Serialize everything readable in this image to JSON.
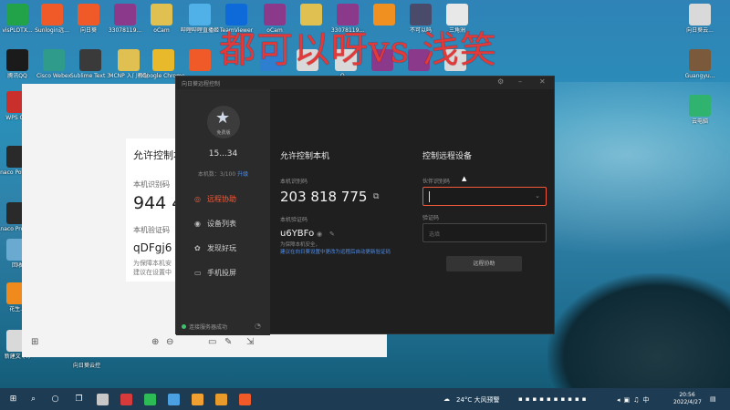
{
  "overlay": {
    "title": "都可以呀vs 浅笑"
  },
  "desktop_icons": [
    {
      "label": "visPLOTX...",
      "color": "#22a34a"
    },
    {
      "label": "Sunlogin远...",
      "color": "#f05a28"
    },
    {
      "label": "向日葵",
      "color": "#f05a28"
    },
    {
      "label": "33078119...",
      "color": "#8b3a8b"
    },
    {
      "label": "oCam",
      "color": "#e0c050"
    },
    {
      "label": "哔哩哔哩直播姬",
      "color": "#4fb1e8"
    },
    {
      "label": "TeamViewer",
      "color": "#0e6ad8"
    },
    {
      "label": "oCam",
      "color": "#8b3a8b"
    },
    {
      "label": "",
      "color": "#e0c050"
    },
    {
      "label": "33078119...",
      "color": "#8b3a8b"
    },
    {
      "label": "",
      "color": "#f09020"
    },
    {
      "label": "不可以吗",
      "color": "#4a4a6a"
    },
    {
      "label": "三角洲",
      "color": "#e8e8e8"
    },
    {
      "label": "腾讯QQ",
      "color": "#1b1b1b"
    },
    {
      "label": "Cisco Webex",
      "color": "#2f9b8b"
    },
    {
      "label": "Sublime Text 3",
      "color": "#3a3a3a"
    },
    {
      "label": "MCNP 入门教程",
      "color": "#e0c050"
    },
    {
      "label": "Google Chrome",
      "color": "#e9b92c"
    },
    {
      "label": "",
      "color": "#f05a28"
    },
    {
      "label": "",
      "color": "#2f7fd1"
    },
    {
      "label": "",
      "color": "#d9d9d9"
    },
    {
      "label": "Q ...",
      "color": "#d9d9d9"
    },
    {
      "label": "",
      "color": "#8b3a8b"
    },
    {
      "label": "",
      "color": "#8b3a8b"
    },
    {
      "label": "",
      "color": "#d9d9d9"
    },
    {
      "label": "WPS O...",
      "color": "#c9302c"
    },
    {
      "label": "Anaco Powers...",
      "color": "#2a2a2a"
    },
    {
      "label": "Anaco Promp...",
      "color": "#2a2a2a"
    },
    {
      "label": "回收",
      "color": "#6aa9d0"
    },
    {
      "label": "花生...",
      "color": "#f08a1c"
    },
    {
      "label": "新建文 (4)",
      "color": "#d9d9d9"
    },
    {
      "label": "向日葵云...",
      "color": "#d9d9d9"
    },
    {
      "label": "Guangyu...",
      "color": "#7a5a3a"
    },
    {
      "label": "云电脑",
      "color": "#2fb36f"
    }
  ],
  "white_window": {
    "card_title": "允许控制本",
    "id_label": "本机识别码",
    "id_value": "944 4",
    "code_label": "本机验证码",
    "code_value": "qDFgj6",
    "note_line1": "为保障本机安",
    "note_line2": "建议在设置中",
    "bottom_label": "向日葵云控"
  },
  "remote_app": {
    "window_title": "向日葵远程控制",
    "avatar_label": "免费版",
    "username": "15...34",
    "device_count": "本机数：3/100",
    "upgrade": "升级",
    "nav": [
      {
        "label": "远程协助",
        "icon": "◎"
      },
      {
        "label": "设备列表",
        "icon": "◉"
      },
      {
        "label": "发现好玩",
        "icon": "✿"
      },
      {
        "label": "手机投屏",
        "icon": "▭"
      }
    ],
    "status": "连接服务器成功",
    "allow_title": "允许控制本机",
    "local_id_label": "本机识别码",
    "local_id": "203 818 775",
    "verify_label": "本机验证码",
    "verify_code": "u6YBFo",
    "note_line1": "为保障本机安全，",
    "note_line2": "建议在向日葵设置中更改为远程后自动更新验证码",
    "control_title": "控制远程设备",
    "partner_label": "伙伴识别码",
    "partner_placeholder": "",
    "verify_input_label": "验证码",
    "verify_placeholder": "选填",
    "connect_button": "远程协助"
  },
  "taskbar": {
    "items": [
      {
        "name": "start",
        "glyph": "⊞",
        "color": ""
      },
      {
        "name": "search",
        "glyph": "⌕",
        "color": ""
      },
      {
        "name": "cortana",
        "glyph": "○",
        "color": ""
      },
      {
        "name": "taskview",
        "glyph": "❐",
        "color": ""
      },
      {
        "name": "app1",
        "glyph": "",
        "color": "#c8c8c8"
      },
      {
        "name": "app2",
        "glyph": "",
        "color": "#d63a3a"
      },
      {
        "name": "wechat",
        "glyph": "",
        "color": "#2dbb55"
      },
      {
        "name": "app4",
        "glyph": "",
        "color": "#4aa0e0"
      },
      {
        "name": "app5",
        "glyph": "",
        "color": "#f0a030"
      },
      {
        "name": "app6",
        "glyph": "",
        "color": "#e89a2a"
      },
      {
        "name": "sunlogin",
        "glyph": "",
        "color": "#f05a28"
      }
    ],
    "weather": "24°C 大风预警",
    "time": "20:56",
    "date": "2022/4/27"
  }
}
